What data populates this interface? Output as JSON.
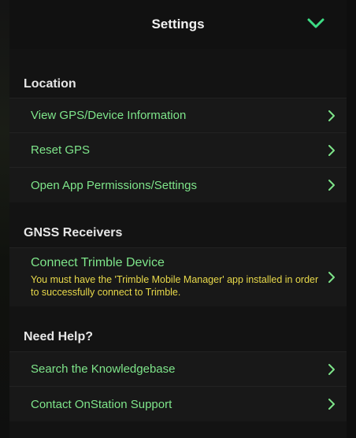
{
  "header": {
    "title": "Settings"
  },
  "sections": {
    "location": {
      "label": "Location",
      "items": [
        {
          "label": "View GPS/Device Information"
        },
        {
          "label": "Reset GPS"
        },
        {
          "label": "Open App Permissions/Settings"
        }
      ]
    },
    "gnss": {
      "label": "GNSS Receivers",
      "items": [
        {
          "label": "Connect Trimble Device",
          "note": "You must have the 'Trimble Mobile Manager' app installed in order to successfully connect to Trimble."
        }
      ]
    },
    "help": {
      "label": "Need Help?",
      "items": [
        {
          "label": "Search the Knowledgebase"
        },
        {
          "label": "Contact OnStation Support"
        }
      ]
    }
  },
  "colors": {
    "accent_green": "#7ee58a",
    "chevron_green": "#3ddc84",
    "warning_yellow": "#e8d94a",
    "background": "#131313"
  },
  "icons": {
    "collapse": "chevron-down-icon",
    "row": "chevron-right-icon"
  }
}
